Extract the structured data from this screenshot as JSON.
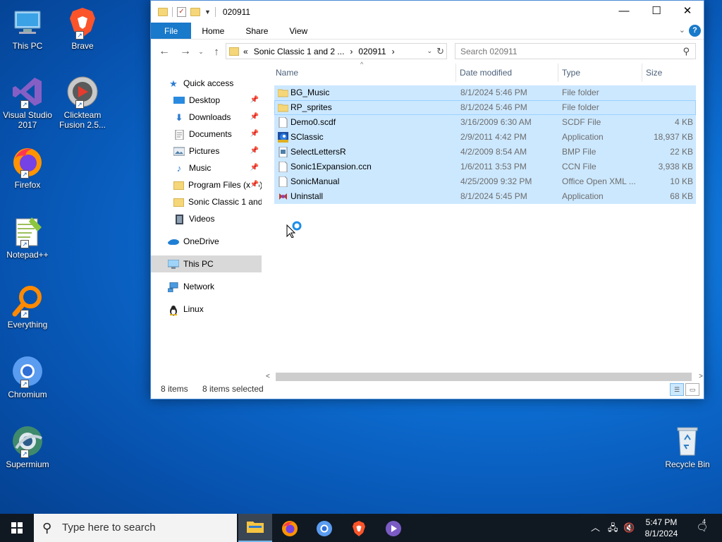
{
  "desktop": {
    "icons": [
      {
        "label": "This PC",
        "icon": "this-pc-icon"
      },
      {
        "label": "Brave",
        "icon": "brave-icon"
      },
      {
        "label": "Visual Studio 2017",
        "icon": "visual-studio-icon"
      },
      {
        "label": "Clickteam Fusion 2.5...",
        "icon": "clickteam-icon"
      },
      {
        "label": "Firefox",
        "icon": "firefox-icon"
      },
      {
        "label": "Notepad++",
        "icon": "notepadpp-icon"
      },
      {
        "label": "Everything",
        "icon": "everything-icon"
      },
      {
        "label": "Chromium",
        "icon": "chromium-icon"
      },
      {
        "label": "Supermium",
        "icon": "supermium-icon"
      },
      {
        "label": "Recycle Bin",
        "icon": "recycle-bin-icon"
      }
    ]
  },
  "explorer": {
    "title": "020911",
    "ribbon_tabs": [
      "File",
      "Home",
      "Share",
      "View"
    ],
    "address": {
      "prefix": "«",
      "crumbs": [
        "Sonic Classic 1 and 2 ...",
        "020911"
      ]
    },
    "search_placeholder": "Search 020911",
    "nav_items": [
      {
        "label": "Quick access",
        "icon": "star-icon",
        "pinned": false,
        "selected": false
      },
      {
        "label": "Desktop",
        "icon": "desktop-icon",
        "pinned": true,
        "selected": false
      },
      {
        "label": "Downloads",
        "icon": "download-icon",
        "pinned": true,
        "selected": false
      },
      {
        "label": "Documents",
        "icon": "documents-icon",
        "pinned": true,
        "selected": false
      },
      {
        "label": "Pictures",
        "icon": "pictures-icon",
        "pinned": true,
        "selected": false
      },
      {
        "label": "Music",
        "icon": "music-icon",
        "pinned": true,
        "selected": false
      },
      {
        "label": "Program Files (x86)",
        "icon": "folder-icon",
        "pinned": true,
        "selected": false
      },
      {
        "label": "Sonic Classic 1 and 2",
        "icon": "folder-icon",
        "pinned": false,
        "selected": false
      },
      {
        "label": "Videos",
        "icon": "videos-icon",
        "pinned": false,
        "selected": false
      },
      {
        "label": "OneDrive",
        "icon": "onedrive-icon",
        "pinned": false,
        "selected": false
      },
      {
        "label": "This PC",
        "icon": "this-pc-icon",
        "pinned": false,
        "selected": true
      },
      {
        "label": "Network",
        "icon": "network-icon",
        "pinned": false,
        "selected": false
      },
      {
        "label": "Linux",
        "icon": "linux-icon",
        "pinned": false,
        "selected": false
      }
    ],
    "columns": {
      "name": "Name",
      "date": "Date modified",
      "type": "Type",
      "size": "Size"
    },
    "files": [
      {
        "name": "BG_Music",
        "date": "8/1/2024 5:46 PM",
        "type": "File folder",
        "size": "",
        "icon": "folder-icon"
      },
      {
        "name": "RP_sprites",
        "date": "8/1/2024 5:46 PM",
        "type": "File folder",
        "size": "",
        "icon": "folder-icon"
      },
      {
        "name": "Demo0.scdf",
        "date": "3/16/2009 6:30 AM",
        "type": "SCDF File",
        "size": "4 KB",
        "icon": "file-icon"
      },
      {
        "name": "SClassic",
        "date": "2/9/2011 4:42 PM",
        "type": "Application",
        "size": "18,937 KB",
        "icon": "sonic-app-icon"
      },
      {
        "name": "SelectLettersR",
        "date": "4/2/2009 8:54 AM",
        "type": "BMP File",
        "size": "22 KB",
        "icon": "bmp-file-icon"
      },
      {
        "name": "Sonic1Expansion.ccn",
        "date": "1/6/2011 3:53 PM",
        "type": "CCN File",
        "size": "3,938 KB",
        "icon": "file-icon"
      },
      {
        "name": "SonicManual",
        "date": "4/25/2009 9:32 PM",
        "type": "Office Open XML ...",
        "size": "10 KB",
        "icon": "file-icon"
      },
      {
        "name": "Uninstall",
        "date": "8/1/2024 5:45 PM",
        "type": "Application",
        "size": "68 KB",
        "icon": "uninstall-icon"
      }
    ],
    "status": {
      "count": "8 items",
      "selected": "8 items selected"
    }
  },
  "taskbar": {
    "search_placeholder": "Type here to search",
    "clock_time": "5:47 PM",
    "clock_date": "8/1/2024",
    "notification_count": "4"
  }
}
